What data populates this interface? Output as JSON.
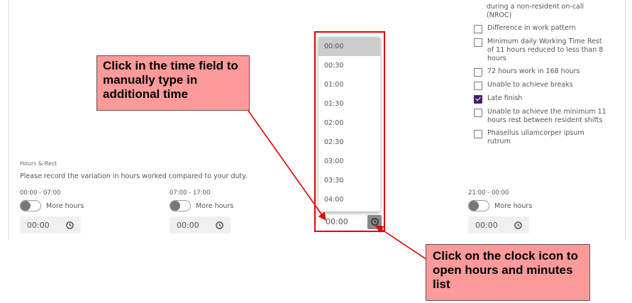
{
  "checklist": {
    "truncated_top": [
      "during a non-resident on-call",
      "(NROC)"
    ],
    "items": [
      {
        "label": "Difference in work pattern",
        "checked": false
      },
      {
        "label": "Minimum daily Working Time Rest of 11 hours reduced to less than 8 hours",
        "checked": false
      },
      {
        "label": "72 hours work in 168 hours",
        "checked": false
      },
      {
        "label": "Unable to achieve breaks",
        "checked": false
      },
      {
        "label": "Late finish",
        "checked": true
      },
      {
        "label": "Unable to achieve the minimum 11 hours rest between resident shifts",
        "checked": false
      },
      {
        "label": "Phasellus ullamcorper ipsum rutrum",
        "checked": false
      }
    ],
    "colors": {
      "checked": "#4b1d72"
    }
  },
  "hours_rest": {
    "title": "Hours & Rest",
    "description": "Please record the variation in hours worked compared to your duty.",
    "slots": [
      {
        "range": "00:00 - 07:00",
        "toggle_label": "More hours",
        "time": "00:00"
      },
      {
        "range": "07:00 - 17:00",
        "toggle_label": "More hours",
        "time": "00:00"
      },
      {
        "range": "21:00 - 00:00",
        "toggle_label": "More hours",
        "time": "00:00"
      }
    ],
    "active_time": "00:00"
  },
  "time_dropdown": {
    "options": [
      "00:00",
      "00:30",
      "01:00",
      "01:30",
      "02:00",
      "02:30",
      "03:00",
      "03:30",
      "04:00"
    ],
    "selected": "00:00"
  },
  "annotations": {
    "callout_time_field": "Click in the time field to manually type in additional time",
    "callout_clock_icon": "Click on the clock icon to open hours and minutes list",
    "color": "#ff9a9a",
    "frame_color": "#e00000"
  },
  "icons": {
    "clock": "clock-icon",
    "checkmark": "checkmark-icon"
  }
}
